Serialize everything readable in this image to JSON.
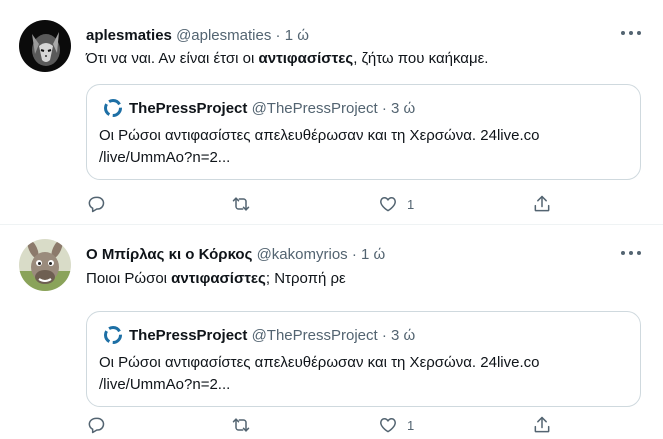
{
  "tweets": [
    {
      "author_name": "aplesmaties",
      "handle": "@aplesmaties",
      "separator": "·",
      "time": "1 ώ",
      "text_before": "Ότι να ναι. Αν είναι έτσι οι ",
      "text_bold": "αντιφασίστες",
      "text_after": ", ζήτω που καήκαμε.",
      "quote": {
        "author_name": "ThePressProject",
        "handle": "@ThePressProject",
        "separator": "·",
        "time": "3 ώ",
        "line1": "Οι Ρώσοι αντιφασίστες απελευθέρωσαν και τη Χερσώνα. 24live.co",
        "line2": "/live/UmmAo?n=2..."
      },
      "likes": "1"
    },
    {
      "author_name": "Ο Μπίρλας κι ο Κόρκος",
      "handle": "@kakomyrios",
      "separator": "·",
      "time": "1 ώ",
      "text_before": "Ποιοι Ρώσοι ",
      "text_bold": "αντιφασίστες",
      "text_after": "; Ντροπή ρε",
      "quote": {
        "author_name": "ThePressProject",
        "handle": "@ThePressProject",
        "separator": "·",
        "time": "3 ώ",
        "line1": "Οι Ρώσοι αντιφασίστες απελευθέρωσαν και τη Χερσώνα. 24live.co",
        "line2": "/live/UmmAo?n=2..."
      },
      "likes": "1"
    }
  ],
  "icons": {
    "reply": "reply-icon",
    "retweet": "retweet-icon",
    "like": "heart-icon",
    "share": "share-icon",
    "more": "more-icon",
    "quote_logo": "thepressproject-logo-icon"
  },
  "colors": {
    "text": "#0f1419",
    "secondary": "#536471",
    "border": "#cfd9de",
    "divider": "#eff3f4",
    "logo": "#1d6fa5"
  }
}
